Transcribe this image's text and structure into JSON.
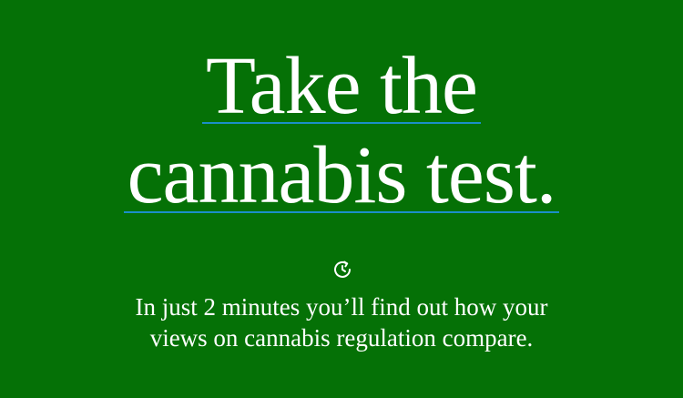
{
  "headline": {
    "line1": "Take the",
    "line2": "cannabis test."
  },
  "icon": "timer-icon",
  "subtitle": {
    "line1": "In just 2 minutes you’ll find out how your",
    "line2": "views on cannabis regulation compare."
  },
  "colors": {
    "background": "#057106",
    "text": "#ffffff",
    "underline": "#1b8fc8"
  }
}
